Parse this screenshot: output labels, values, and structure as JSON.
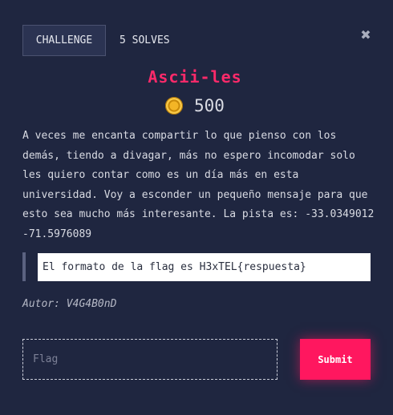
{
  "tabs": {
    "challenge_label": "CHALLENGE",
    "solves_label": "5 SOLVES"
  },
  "close_icon": "close-icon",
  "challenge": {
    "title": "Ascii-les",
    "points": "500",
    "points_icon": "coin-icon",
    "description": "A veces me encanta compartir lo que pienso con los demás, tiendo a divagar, más no espero incomodar solo les quiero contar como es un día más en esta universidad. Voy a esconder un pequeño mensaje para que esto sea mucho más interesante. La pista es: -33.0349012 -71.5976089",
    "hint": "El formato de la flag es H3xTEL{respuesta}",
    "author": "Autor: V4G4B0nD"
  },
  "form": {
    "flag_placeholder": "Flag",
    "flag_value": "",
    "submit_label": "Submit"
  },
  "colors": {
    "background": "#1f2640",
    "accent": "#ff175f",
    "title": "#ff2a6a"
  }
}
